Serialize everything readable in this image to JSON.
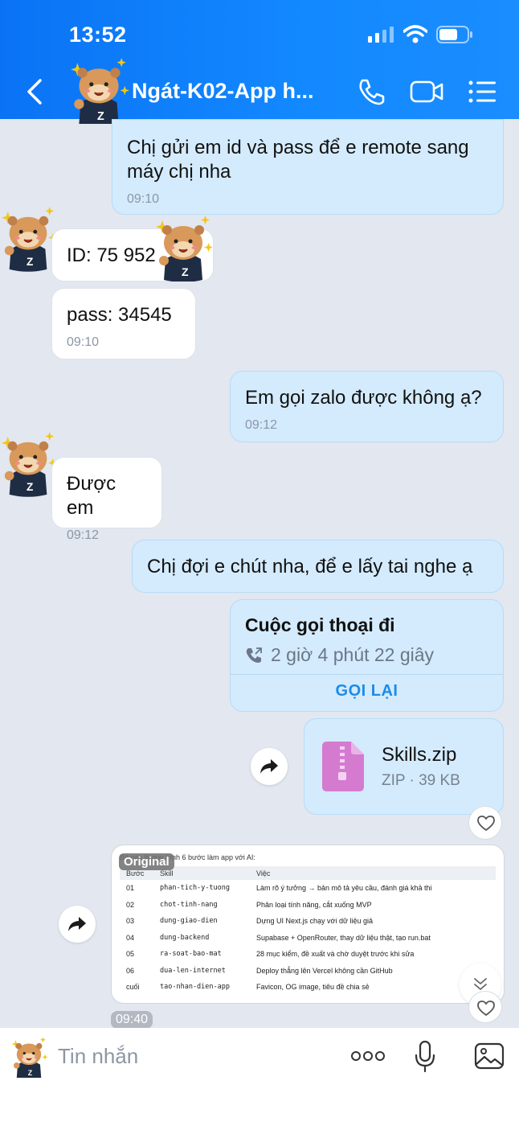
{
  "status_bar": {
    "time": "13:52"
  },
  "header": {
    "title": "Ngát-K02-App h..."
  },
  "messages": [
    {
      "text": "Chị gửi em id và pass để e remote sang máy chị nha",
      "time": "09:10"
    },
    {
      "text": "ID: 75 952"
    },
    {
      "text": "pass: 34545",
      "time": "09:10"
    },
    {
      "text": "Em gọi zalo được không ạ?",
      "time": "09:12"
    },
    {
      "text": "Được em",
      "time": "09:12"
    },
    {
      "text": "Chị đợi e chút nha, để e lấy tai nghe ạ"
    }
  ],
  "call_card": {
    "title": "Cuộc gọi thoại đi",
    "duration": "2 giờ 4 phút 22 giây",
    "action": "GỌI LẠI"
  },
  "file_card": {
    "name": "Skills.zip",
    "meta": "ZIP · 39 KB"
  },
  "image_message": {
    "badge": "Original",
    "intro": "Bộ này là quy trình 6 bước làm app với AI:",
    "headers": [
      "Bước",
      "Skill",
      "Việc"
    ],
    "rows": [
      [
        "01",
        "phan-tich-y-tuong",
        "Làm rõ ý tưởng → bản mô tả yêu cầu, đánh giá khả thi"
      ],
      [
        "02",
        "chot-tinh-nang",
        "Phân loại tính năng, cắt xuống MVP"
      ],
      [
        "03",
        "dung-giao-dien",
        "Dựng UI Next.js chạy với dữ liệu giả"
      ],
      [
        "04",
        "dung-backend",
        "Supabase + OpenRouter, thay dữ liệu thật, tạo run.bat"
      ],
      [
        "05",
        "ra-soat-bao-mat",
        "28 mục kiểm, đề xuất và chờ duyệt trước khi sửa"
      ],
      [
        "06",
        "dua-len-internet",
        "Deploy thẳng lên Vercel không cần GitHub"
      ],
      [
        "cuối",
        "tao-nhan-dien-app",
        "Favicon, OG image, tiêu đề chia sẻ"
      ]
    ],
    "time": "09:40"
  },
  "input": {
    "placeholder": "Tin nhắn"
  },
  "colors": {
    "header_blue": "#0a73f5",
    "outgoing_bubble": "#d4ebfd",
    "incoming_bubble": "#ffffff",
    "chat_bg": "#e2e7f0",
    "link_blue": "#1c8be8"
  },
  "icons": [
    "back-icon",
    "phone-icon",
    "video-call-icon",
    "menu-icon",
    "phone-outgoing-icon",
    "zip-file-icon",
    "share-icon",
    "heart-icon",
    "chevron-down-icon",
    "more-icon",
    "microphone-icon",
    "image-icon"
  ]
}
